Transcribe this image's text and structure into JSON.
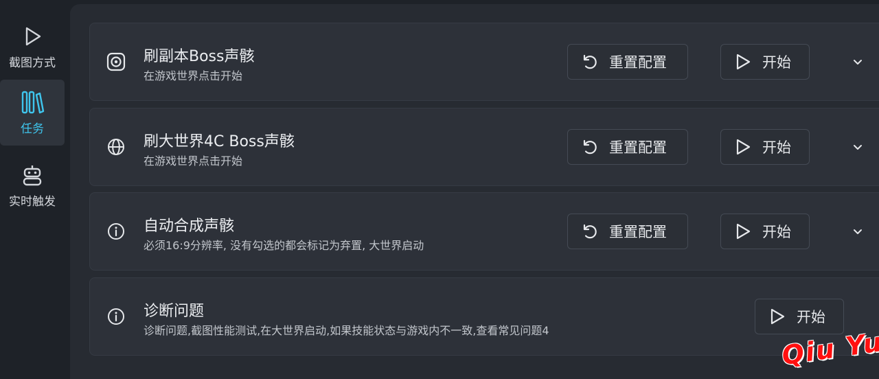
{
  "sidebar": {
    "items": [
      {
        "label": "截图方式",
        "icon": "play-icon",
        "active": false
      },
      {
        "label": "任务",
        "icon": "library-icon",
        "active": true
      },
      {
        "label": "实时触发",
        "icon": "robot-icon",
        "active": false
      }
    ]
  },
  "tasks": [
    {
      "title": "刷副本Boss声骸",
      "subtitle": "在游戏世界点击开始",
      "icon": "target-icon",
      "reset_label": "重置配置",
      "start_label": "开始"
    },
    {
      "title": "刷大世界4C Boss声骸",
      "subtitle": "在游戏世界点击开始",
      "icon": "globe-icon",
      "reset_label": "重置配置",
      "start_label": "开始"
    },
    {
      "title": "自动合成声骸",
      "subtitle": "必须16:9分辨率, 没有勾选的都会标记为弃置, 大世界启动",
      "icon": "info-icon",
      "reset_label": "重置配置",
      "start_label": "开始"
    },
    {
      "title": "诊断问题",
      "subtitle": "诊断问题,截图性能测试,在大世界启动,如果技能状态与游戏内不一致,查看常见问题4",
      "icon": "info-icon",
      "start_label": "开始"
    }
  ],
  "watermark": "Qiu Yue",
  "colors": {
    "accent": "#3fc6ee",
    "background": "#1e2228",
    "card": "#2d3139"
  }
}
